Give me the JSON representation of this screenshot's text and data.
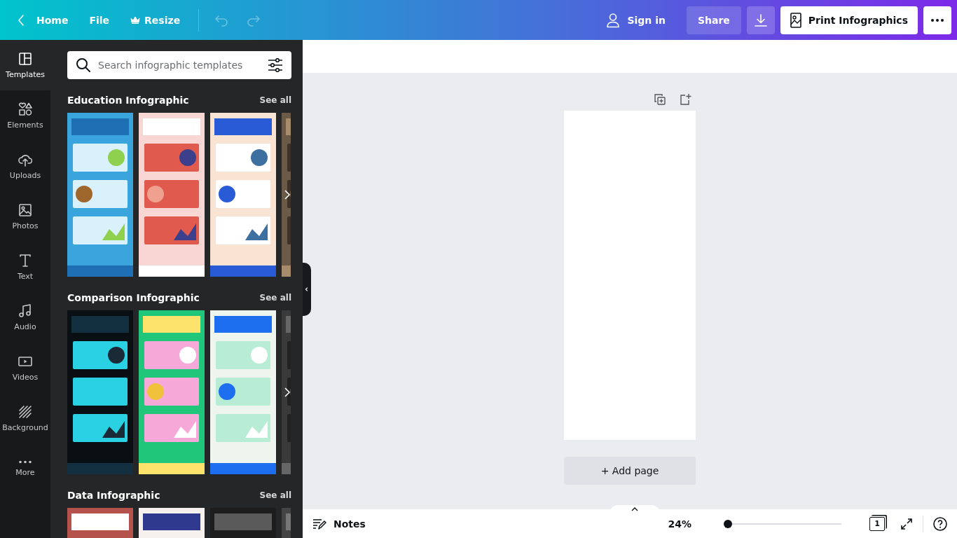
{
  "topbar": {
    "home": "Home",
    "file": "File",
    "resize": "Resize",
    "history": [
      {
        "kind": "undo",
        "disabled": true
      },
      {
        "kind": "redo",
        "disabled": true
      }
    ],
    "sign_in": "Sign in",
    "share": "Share",
    "print": "Print Infographics"
  },
  "rail": [
    {
      "kind": "templates",
      "label": "Templates",
      "selected": true
    },
    {
      "kind": "elements",
      "label": "Elements",
      "selected": false
    },
    {
      "kind": "uploads",
      "label": "Uploads",
      "selected": false
    },
    {
      "kind": "photos",
      "label": "Photos",
      "selected": false
    },
    {
      "kind": "text",
      "label": "Text",
      "selected": false
    },
    {
      "kind": "audio",
      "label": "Audio",
      "selected": false
    },
    {
      "kind": "videos",
      "label": "Videos",
      "selected": false
    },
    {
      "kind": "background",
      "label": "Background",
      "selected": false
    },
    {
      "kind": "more",
      "label": "More",
      "selected": false
    }
  ],
  "search": {
    "placeholder": "Search infographic templates"
  },
  "sections": [
    {
      "title": "Education Infographic",
      "see_all": "See all",
      "has_next": true
    },
    {
      "title": "Comparison Infographic",
      "see_all": "See all",
      "has_next": true
    },
    {
      "title": "Data Infographic",
      "see_all": "See all"
    }
  ],
  "editor": {
    "add_page": "+ Add page"
  },
  "footer": {
    "notes": "Notes",
    "zoom": "24%",
    "zoom_slider": {
      "level": 0
    },
    "page_count": "1"
  }
}
